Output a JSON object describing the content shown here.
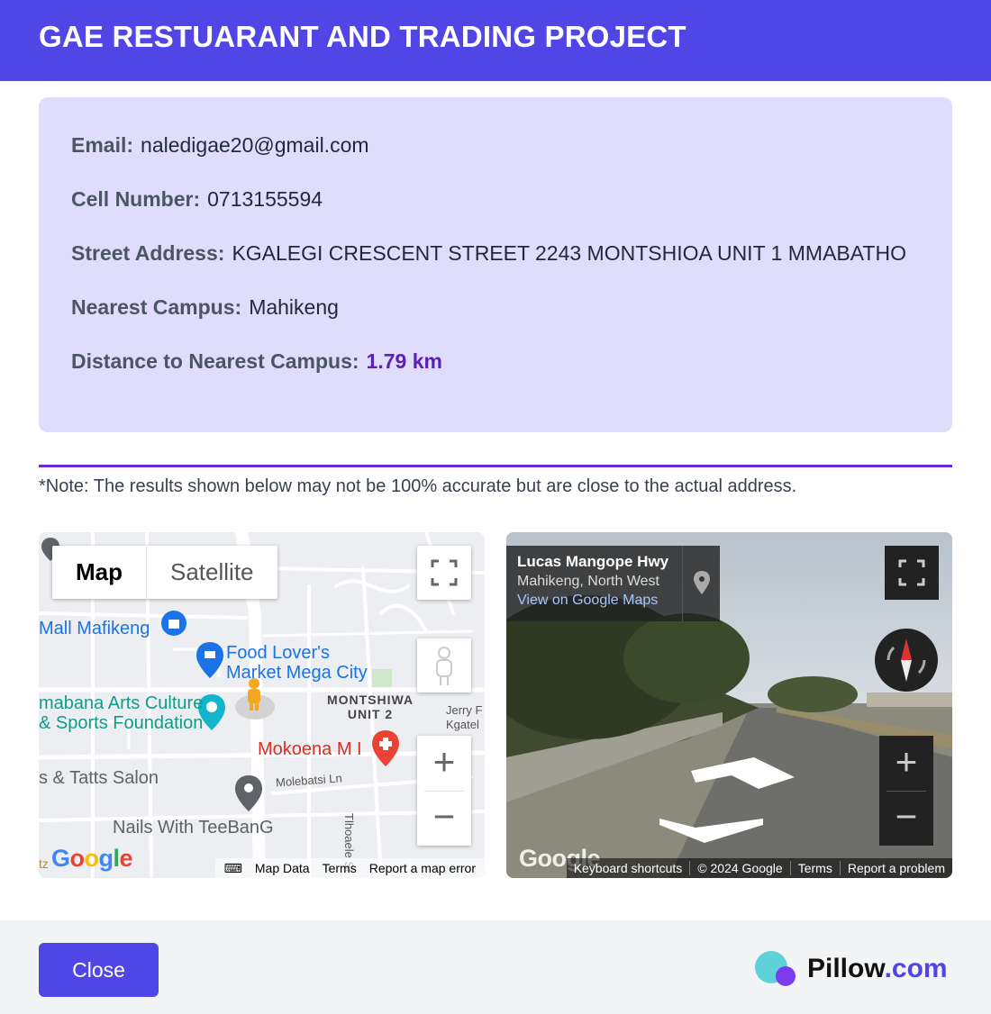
{
  "header": {
    "title": "GAE RESTUARANT AND TRADING PROJECT"
  },
  "details": {
    "email_label": "Email:",
    "email_value": "naledigae20@gmail.com",
    "cell_label": "Cell Number:",
    "cell_value": "0713155594",
    "address_label": "Street Address:",
    "address_value": "KGALEGI CRESCENT STREET 2243 MONTSHIOA UNIT 1 MMABATHO",
    "campus_label": "Nearest Campus:",
    "campus_value": "Mahikeng",
    "distance_label": "Distance to Nearest Campus:",
    "distance_value": "1.79 km"
  },
  "note": "*Note: The results shown below may not be 100% accurate but are close to the actual address.",
  "map": {
    "tab_map": "Map",
    "tab_satellite": "Satellite",
    "zoom_in": "+",
    "zoom_out": "−",
    "labels": {
      "mall": "Mall Mafikeng",
      "food_lovers_1": "Food Lover's",
      "food_lovers_2": "Market Mega City",
      "arts_1": "mabana Arts Culture",
      "arts_2": "& Sports Foundation",
      "area_1": "MONTSHIWA",
      "area_2": "UNIT 2",
      "mokoena": "Mokoena M I",
      "tatts": "s & Tatts Salon",
      "molebatsi": "Molebatsi Ln",
      "nails": "Nails With TeeBanG",
      "tlhoaele": "Tlhoaele St",
      "jerry_1": "Jerry F",
      "jerry_2": "Kgatel",
      "tz": "tz"
    },
    "logo": "Google",
    "footer": {
      "map_data": "Map Data",
      "terms": "Terms",
      "report": "Report a map error"
    }
  },
  "streetview": {
    "road": "Lucas Mangope Hwy",
    "place": "Mahikeng, North West",
    "link": "View on Google Maps",
    "zoom_in": "+",
    "zoom_out": "−",
    "logo": "Google",
    "footer": {
      "shortcuts": "Keyboard shortcuts",
      "copyright": "© 2024 Google",
      "terms": "Terms",
      "report": "Report a problem"
    }
  },
  "footer": {
    "close_label": "Close",
    "brand_name": "Pillow",
    "brand_domain": ".com"
  },
  "colors": {
    "primary": "#4f46e5",
    "card_bg": "#e0dcfb",
    "accent_text": "#5b21b6",
    "divider": "#6d28d9"
  }
}
